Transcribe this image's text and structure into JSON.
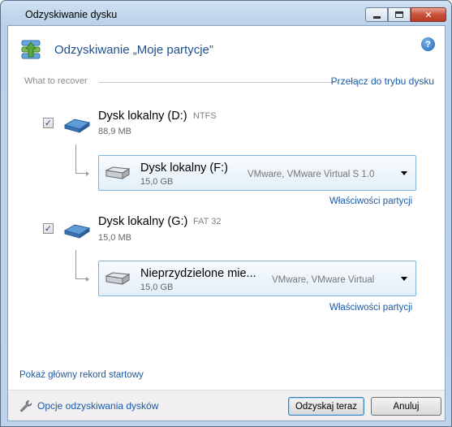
{
  "window": {
    "title": "Odzyskiwanie dysku",
    "accent": "#1e4f8e",
    "link_color": "#1c5aa6"
  },
  "header": {
    "title": "Odzyskiwanie „Moje partycje”",
    "help": "?"
  },
  "section": {
    "label": "What to recover",
    "switch_link": "Przełącz do trybu dysku"
  },
  "sources": [
    {
      "checked": true,
      "name": "Dysk lokalny (D:)",
      "fs": "NTFS",
      "size": "88,9 MB",
      "target": {
        "name": "Dysk lokalny (F:)",
        "size": "15,0 GB",
        "device": "VMware, VMware Virtual S 1.0"
      },
      "properties_link": "Właściwości partycji"
    },
    {
      "checked": true,
      "name": "Dysk lokalny (G:)",
      "fs": "FAT 32",
      "size": "15,0 MB",
      "target": {
        "name": "Nieprzydzielone mie...",
        "size": "15,0 GB",
        "device": "VMware, VMware Virtual"
      },
      "properties_link": "Właściwości partycji"
    }
  ],
  "mbr_link": "Pokaż główny rekord startowy",
  "footer": {
    "options_link": "Opcje odzyskiwania dysków",
    "recover_button": "Odzyskaj teraz",
    "cancel_button": "Anuluj"
  }
}
